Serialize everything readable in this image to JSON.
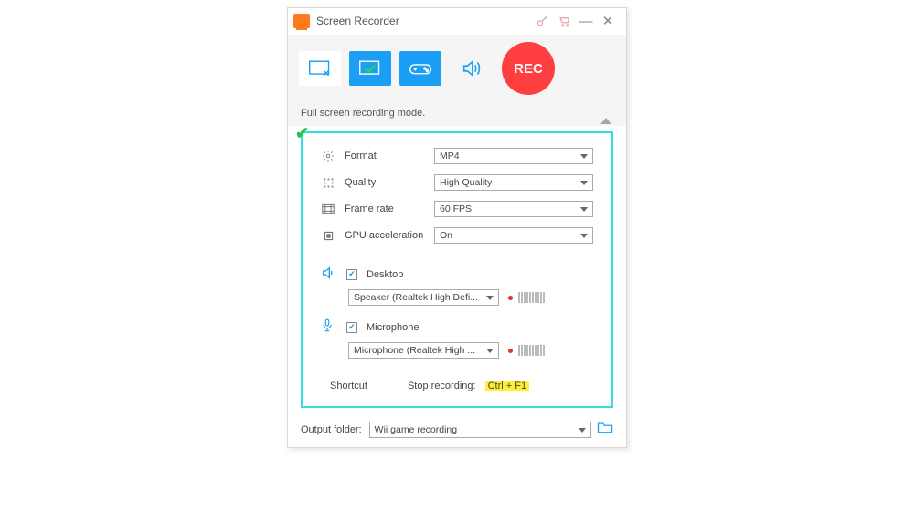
{
  "title": "Screen Recorder",
  "mode_text": "Full screen recording mode.",
  "rec_label": "REC",
  "settings": {
    "format": {
      "label": "Format",
      "value": "MP4"
    },
    "quality": {
      "label": "Quality",
      "value": "High Quality"
    },
    "fps": {
      "label": "Frame rate",
      "value": "60 FPS"
    },
    "gpu": {
      "label": "GPU acceleration",
      "value": "On"
    }
  },
  "audio": {
    "desktop": {
      "label": "Desktop",
      "device": "Speaker (Realtek High Defi..."
    },
    "mic": {
      "label": "Microphone",
      "device": "Microphone (Realtek High ..."
    }
  },
  "shortcut": {
    "heading": "Shortcut",
    "stop_label": "Stop recording:",
    "hotkey": "Ctrl + F1"
  },
  "output": {
    "label": "Output folder:",
    "value": "Wii game recording"
  }
}
